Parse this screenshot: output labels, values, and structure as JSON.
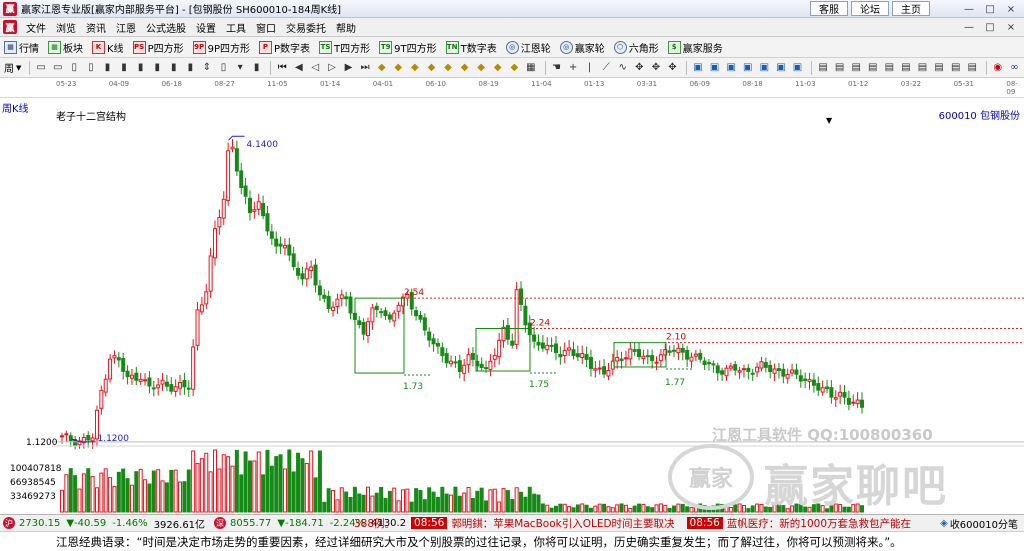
{
  "window": {
    "app_icon": "赢",
    "title": "赢家江恩专业版[赢家内部服务平台] - [包钢股份  SH600010-184周K线]",
    "links": [
      "客服",
      "论坛",
      "主页"
    ],
    "controls": [
      "—",
      "□",
      "×"
    ]
  },
  "menu": {
    "items": [
      "文件",
      "浏览",
      "资讯",
      "江恩",
      "公式选股",
      "设置",
      "工具",
      "窗口",
      "交易委托",
      "帮助"
    ],
    "right_controls": [
      "—",
      "□",
      "×"
    ]
  },
  "toolbar": {
    "items": [
      {
        "icon": "grid-icon",
        "glyph": "▦",
        "label": "行情"
      },
      {
        "icon": "blocks-icon",
        "glyph": "▦",
        "label": "板块"
      },
      {
        "icon": "kline-icon",
        "glyph": "K",
        "label": "K线"
      },
      {
        "icon": "p-square-icon",
        "glyph": "PS",
        "label": "P四方形"
      },
      {
        "icon": "9p-square-icon",
        "glyph": "9P",
        "label": "9P四方形"
      },
      {
        "icon": "p-numbers-icon",
        "glyph": "P",
        "label": "P数字表"
      },
      {
        "icon": "t-square-icon",
        "glyph": "TS",
        "label": "T四方形"
      },
      {
        "icon": "9t-square-icon",
        "glyph": "T9",
        "label": "9T四方形"
      },
      {
        "icon": "t-numbers-icon",
        "glyph": "TN",
        "label": "T数字表"
      },
      {
        "icon": "gann-wheel-icon",
        "glyph": "◎",
        "label": "江恩轮"
      },
      {
        "icon": "winner-wheel-icon",
        "glyph": "◎",
        "label": "赢家轮"
      },
      {
        "icon": "hexagon-icon",
        "glyph": "⬡",
        "label": "六角形"
      },
      {
        "icon": "dollar-icon",
        "glyph": "$",
        "label": "赢家服务"
      }
    ],
    "period_selector": "周",
    "period_tab": "周K线"
  },
  "chart_header": {
    "indicator": "老子十二宫结构",
    "code": "600010",
    "name": "包钢股份"
  },
  "time_axis_ticks": [
    "05-23",
    "04-09",
    "06-18",
    "08-27",
    "11-05",
    "01-14",
    "04-01",
    "06-10",
    "08-19",
    "11-04",
    "01-13",
    "03-31",
    "06-09",
    "08-18",
    "11-03",
    "01-12",
    "03-22",
    "05-31",
    "08-09"
  ],
  "chart_data": {
    "type": "candlestick",
    "price_annotations": [
      {
        "label": "4.1400",
        "kind": "high"
      },
      {
        "label": "1.1200",
        "kind": "low"
      },
      {
        "label": "2.54",
        "kind": "resistance"
      },
      {
        "label": "2.24",
        "kind": "resistance"
      },
      {
        "label": "2.10",
        "kind": "resistance"
      },
      {
        "label": "1.73",
        "kind": "box-low"
      },
      {
        "label": "1.75",
        "kind": "box-low"
      },
      {
        "label": "1.77",
        "kind": "box-low"
      }
    ],
    "y_axis_price_label": "1.1200",
    "volume_labels": [
      "100407818",
      "66938545",
      "33469273"
    ],
    "price_range": [
      1.0,
      4.3
    ]
  },
  "watermark": {
    "line1": "江恩工具软件  QQ:100800360",
    "logo": "赢家",
    "brand": "赢家聊吧"
  },
  "status_bar": {
    "icon1": "沪",
    "sh_index": "2730.15",
    "sh_change": "▼-40.59",
    "sh_pct": "-1.46%",
    "sh_amount": "3926.61亿",
    "icon2": "深",
    "sz_index": "8055.77",
    "sz_change": "▼-184.71",
    "sz_pct": "-2.24%",
    "sz_amount": "4130.2",
    "ticker": [
      {
        "time": "",
        "text": "388例。"
      },
      {
        "time": "08:56",
        "text": "郭明錤：苹果MacBook引入OLED时间主要取决"
      },
      {
        "time": "08:56",
        "text": "蓝帆医疗：新的1000万套急救包产能在"
      }
    ],
    "right_text": "收600010分笔"
  },
  "quote_bar": {
    "text": "江恩经典语录：“时间是决定市场走势的重要因素，经过详细研究大市及个别股票的过往记录，你将可以证明，历史确实重复发生；而了解过往，你将可以预测将来。”。"
  },
  "colors": {
    "up": "#e8141e",
    "down": "#168a16",
    "annotation": "#d00000",
    "level_line": "#e41e1e",
    "box": "#0f8c0f",
    "peak_marker": "#1c1cd0"
  }
}
